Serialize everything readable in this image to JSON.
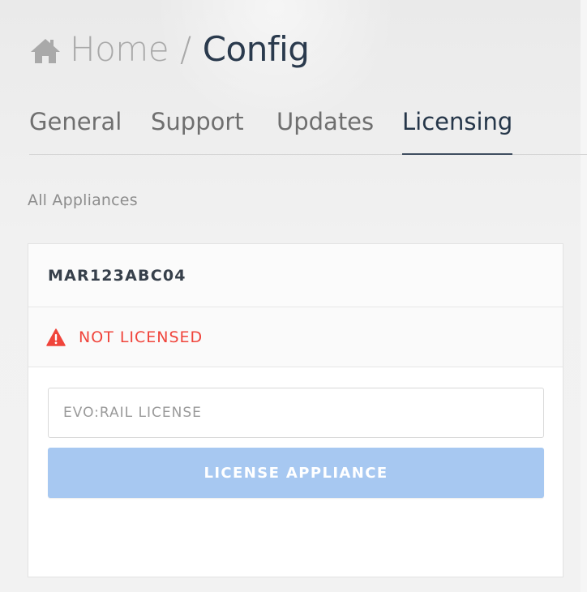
{
  "breadcrumb": {
    "home_icon": "home-icon",
    "home_label": "Home",
    "separator": "/",
    "current_label": "Config"
  },
  "tabs": [
    {
      "label": "General",
      "active": false
    },
    {
      "label": "Support",
      "active": false
    },
    {
      "label": "Updates",
      "active": false
    },
    {
      "label": "Licensing",
      "active": true
    }
  ],
  "section": {
    "title": "All Appliances"
  },
  "appliance": {
    "id": "MAR123ABC04",
    "status_icon": "warning-icon",
    "status_text": "NOT LICENSED",
    "status_color": "#f0443b",
    "license_input": {
      "value": "",
      "placeholder": "EVO:RAIL LICENSE"
    },
    "license_button_label": "LICENSE APPLIANCE",
    "license_button_color": "#a7c8f1"
  }
}
